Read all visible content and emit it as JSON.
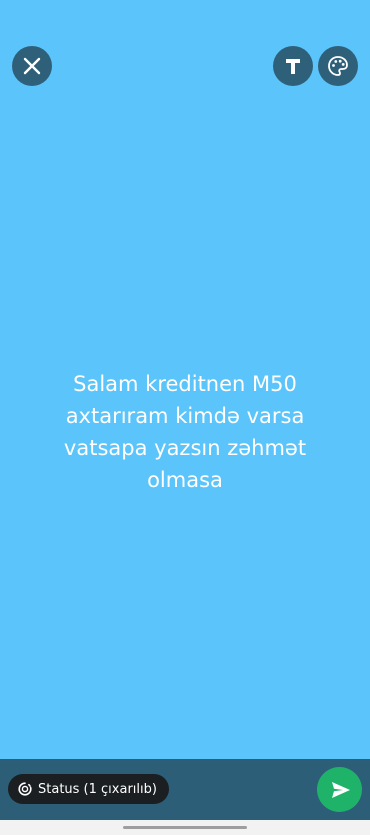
{
  "status_text": "Salam kreditnen M50 axtarıram kimdə varsa vatsapa yazsın zəhmət olmasa",
  "audience": {
    "label": "Status (1 çıxarılıb)",
    "icon": "status-ring-icon"
  },
  "toolbar": {
    "close_icon": "close-icon",
    "text_tool_icon": "text-tool-icon",
    "palette_icon": "palette-icon"
  },
  "send": {
    "icon": "send-icon"
  },
  "colors": {
    "background": "#5bc4fb",
    "bottom_bar": "#2c5e78",
    "send_button": "#1fb36a",
    "top_buttons": "#2f6079"
  }
}
